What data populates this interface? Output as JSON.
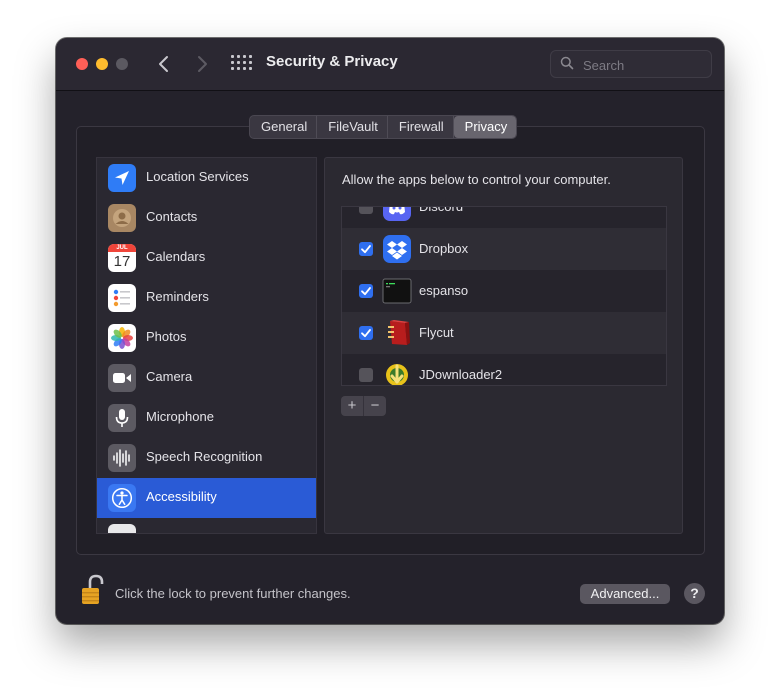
{
  "window": {
    "title": "Security & Privacy",
    "nav_back": "‹",
    "nav_forward": "›"
  },
  "search": {
    "placeholder": "Search"
  },
  "tabs": [
    {
      "label": "General",
      "active": false
    },
    {
      "label": "FileVault",
      "active": false
    },
    {
      "label": "Firewall",
      "active": false
    },
    {
      "label": "Privacy",
      "active": true
    }
  ],
  "sidebar": {
    "items": [
      {
        "label": "Location Services",
        "icon": "location-icon"
      },
      {
        "label": "Contacts",
        "icon": "contacts-icon"
      },
      {
        "label": "Calendars",
        "icon": "calendar-icon",
        "icon_month": "JUL",
        "icon_day": "17"
      },
      {
        "label": "Reminders",
        "icon": "reminders-icon"
      },
      {
        "label": "Photos",
        "icon": "photos-icon"
      },
      {
        "label": "Camera",
        "icon": "camera-icon"
      },
      {
        "label": "Microphone",
        "icon": "microphone-icon"
      },
      {
        "label": "Speech Recognition",
        "icon": "speech-icon"
      },
      {
        "label": "Accessibility",
        "icon": "accessibility-icon",
        "selected": true
      }
    ]
  },
  "panel": {
    "description": "Allow the apps below to control your computer.",
    "apps": [
      {
        "label": "Discord",
        "checked": false,
        "icon": "discord-icon"
      },
      {
        "label": "Dropbox",
        "checked": true,
        "icon": "dropbox-icon"
      },
      {
        "label": "espanso",
        "checked": true,
        "icon": "espanso-icon"
      },
      {
        "label": "Flycut",
        "checked": true,
        "icon": "flycut-icon"
      },
      {
        "label": "JDownloader2",
        "checked": false,
        "icon": "jdownloader-icon"
      }
    ],
    "add_label": "+",
    "remove_label": "−"
  },
  "footer": {
    "lock_text": "Click the lock to prevent further changes.",
    "advanced_label": "Advanced...",
    "help_label": "?"
  },
  "colors": {
    "accent": "#2a5bd6",
    "checkbox": "#2f6ff0",
    "window_bg": "#24222b"
  }
}
